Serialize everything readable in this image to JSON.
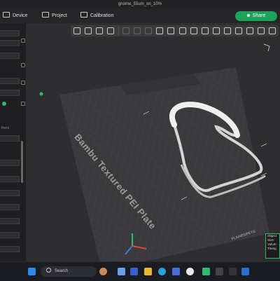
{
  "window": {
    "title": "gnome_55um_on_10%"
  },
  "nav": {
    "device": "Device",
    "project": "Project",
    "calibration": "Calibration",
    "share": "Share"
  },
  "sidebar": {
    "section_text": "thers"
  },
  "viewport": {
    "plate_label": "Bambu Textured PEI Plate",
    "plate_footer": "PLA/ABS/PETG",
    "info": [
      "Object",
      "Size:",
      "Volum",
      "Triang"
    ]
  },
  "taskbar": {
    "search_placeholder": "Search"
  },
  "colors": {
    "accent": "#1da25c",
    "plate": "#3a3a3d",
    "model": "#e8e8e8"
  }
}
